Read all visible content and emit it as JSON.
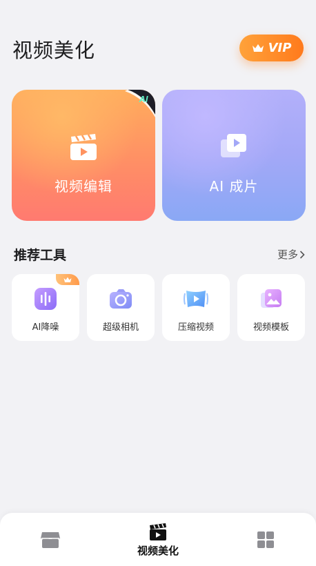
{
  "header": {
    "title": "视频美化",
    "vip_label": "VIP"
  },
  "feature_cards": [
    {
      "label": "视频编辑",
      "icon": "clapperboard-icon",
      "badge": "AI"
    },
    {
      "label": "AI 成片",
      "icon": "stacked-video-icon"
    }
  ],
  "tools_section": {
    "title": "推荐工具",
    "more_label": "更多"
  },
  "tools": [
    {
      "label": "AI降噪",
      "icon": "audio-wave-icon",
      "badge": "crown"
    },
    {
      "label": "超级相机",
      "icon": "camera-icon"
    },
    {
      "label": "压缩视频",
      "icon": "compress-video-icon"
    },
    {
      "label": "视频模板",
      "icon": "template-icon"
    }
  ],
  "bottom_nav": {
    "items": [
      {
        "name": "store",
        "icon": "store-icon"
      },
      {
        "name": "video",
        "icon": "clapperboard-icon",
        "label": "视频美化",
        "active": true
      },
      {
        "name": "apps",
        "icon": "grid-icon"
      }
    ]
  },
  "colors": {
    "vip_gradient": [
      "#ffa23a",
      "#ff7a1c"
    ],
    "edit_card_gradient": [
      "#ffad5c",
      "#ff7a70"
    ],
    "ai_card_gradient": [
      "#b3b0fa",
      "#8aa8f5"
    ],
    "page_background": "#f2f2f5"
  }
}
